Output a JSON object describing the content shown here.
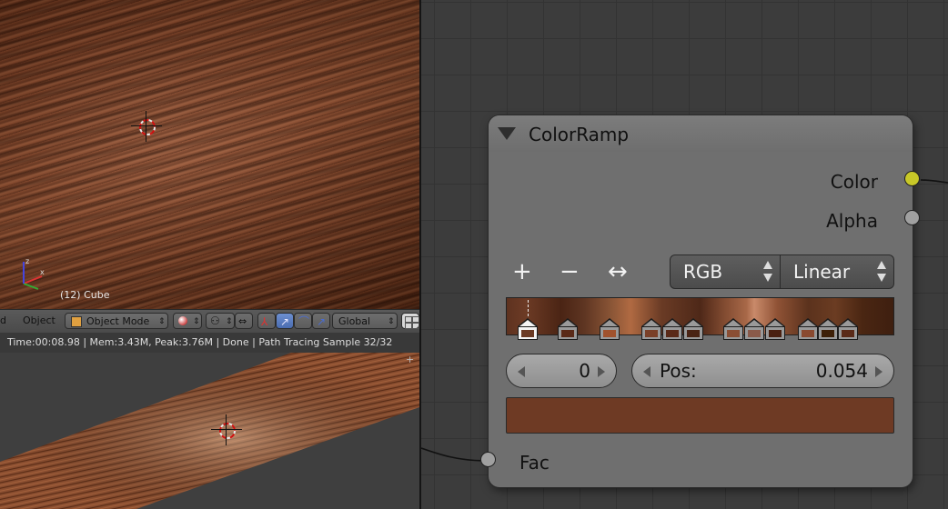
{
  "viewport_top": {
    "object_label": "(12) Cube"
  },
  "header": {
    "menu_partial": "d",
    "menu_object": "Object",
    "mode": "Object Mode",
    "orientation": "Global"
  },
  "status": {
    "text": "Time:00:08.98 | Mem:3.43M, Peak:3.76M | Done | Path Tracing Sample 32/32"
  },
  "node": {
    "title": "ColorRamp",
    "outputs": {
      "color": "Color",
      "alpha": "Alpha"
    },
    "input": "Fac",
    "color_mode": "RGB",
    "interpolation": "Linear",
    "active_index": "0",
    "pos_label": "Pos:",
    "pos_value": "0.054",
    "selected_color": "#6e3a24",
    "stop_colors": [
      "#6b3a24",
      "#5a2a18",
      "#a0522d",
      "#7a4028",
      "#5a2a18",
      "#4a2414",
      "#8a4e34",
      "#8a5a4a",
      "#4a2010",
      "#8a4a30",
      "#3e2008",
      "#5a2a18"
    ],
    "socket_colors": {
      "color": "#c8c828",
      "alpha": "#a0a0a0",
      "fac": "#a0a0a0"
    }
  },
  "icons": {
    "add": "+",
    "remove": "−",
    "flip": "↔"
  }
}
